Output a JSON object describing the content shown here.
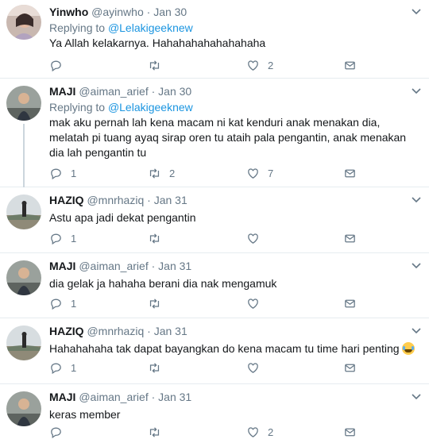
{
  "colors": {
    "link": "#1b95e0",
    "muted": "#657786",
    "text": "#14171a",
    "divider": "#e6ecf0"
  },
  "tweets": [
    {
      "name": "Yinwho",
      "handle": "@ayinwho",
      "sep": "·",
      "date": "Jan 30",
      "reply_prefix": "Replying to",
      "reply_to": "@Lelakigeeknew",
      "text": "Ya Allah kelakarnya. Hahahahahahahahaha",
      "replies": "",
      "retweets": "",
      "likes": "2",
      "avatar": "person-photo"
    },
    {
      "name": "MAJI",
      "handle": "@aiman_arief",
      "sep": "·",
      "date": "Jan 30",
      "reply_prefix": "Replying to",
      "reply_to": "@Lelakigeeknew",
      "text": "mak aku pernah lah kena macam ni kat kenduri anak menakan dia, melatah pi tuang ayaq sirap oren tu ataih pala pengantin, anak menakan dia lah pengantin tu",
      "replies": "1",
      "retweets": "2",
      "likes": "7",
      "avatar": "person-photo"
    },
    {
      "name": "HAZIQ",
      "handle": "@mnrhaziq",
      "sep": "·",
      "date": "Jan 31",
      "text": "Astu apa jadi dekat pengantin",
      "replies": "1",
      "retweets": "",
      "likes": "",
      "avatar": "landscape-photo"
    },
    {
      "name": "MAJI",
      "handle": "@aiman_arief",
      "sep": "·",
      "date": "Jan 31",
      "text": "dia gelak ja hahaha berani dia nak mengamuk",
      "replies": "1",
      "retweets": "",
      "likes": "",
      "avatar": "person-photo"
    },
    {
      "name": "HAZIQ",
      "handle": "@mnrhaziq",
      "sep": "·",
      "date": "Jan 31",
      "text": "Hahahahaha tak dapat bayangkan do kena macam tu time hari penting",
      "emoji": "face-with-tears-of-joy",
      "replies": "1",
      "retweets": "",
      "likes": "",
      "avatar": "landscape-photo"
    },
    {
      "name": "MAJI",
      "handle": "@aiman_arief",
      "sep": "·",
      "date": "Jan 31",
      "text": "keras member",
      "replies": "",
      "retweets": "",
      "likes": "2",
      "avatar": "person-photo"
    }
  ]
}
